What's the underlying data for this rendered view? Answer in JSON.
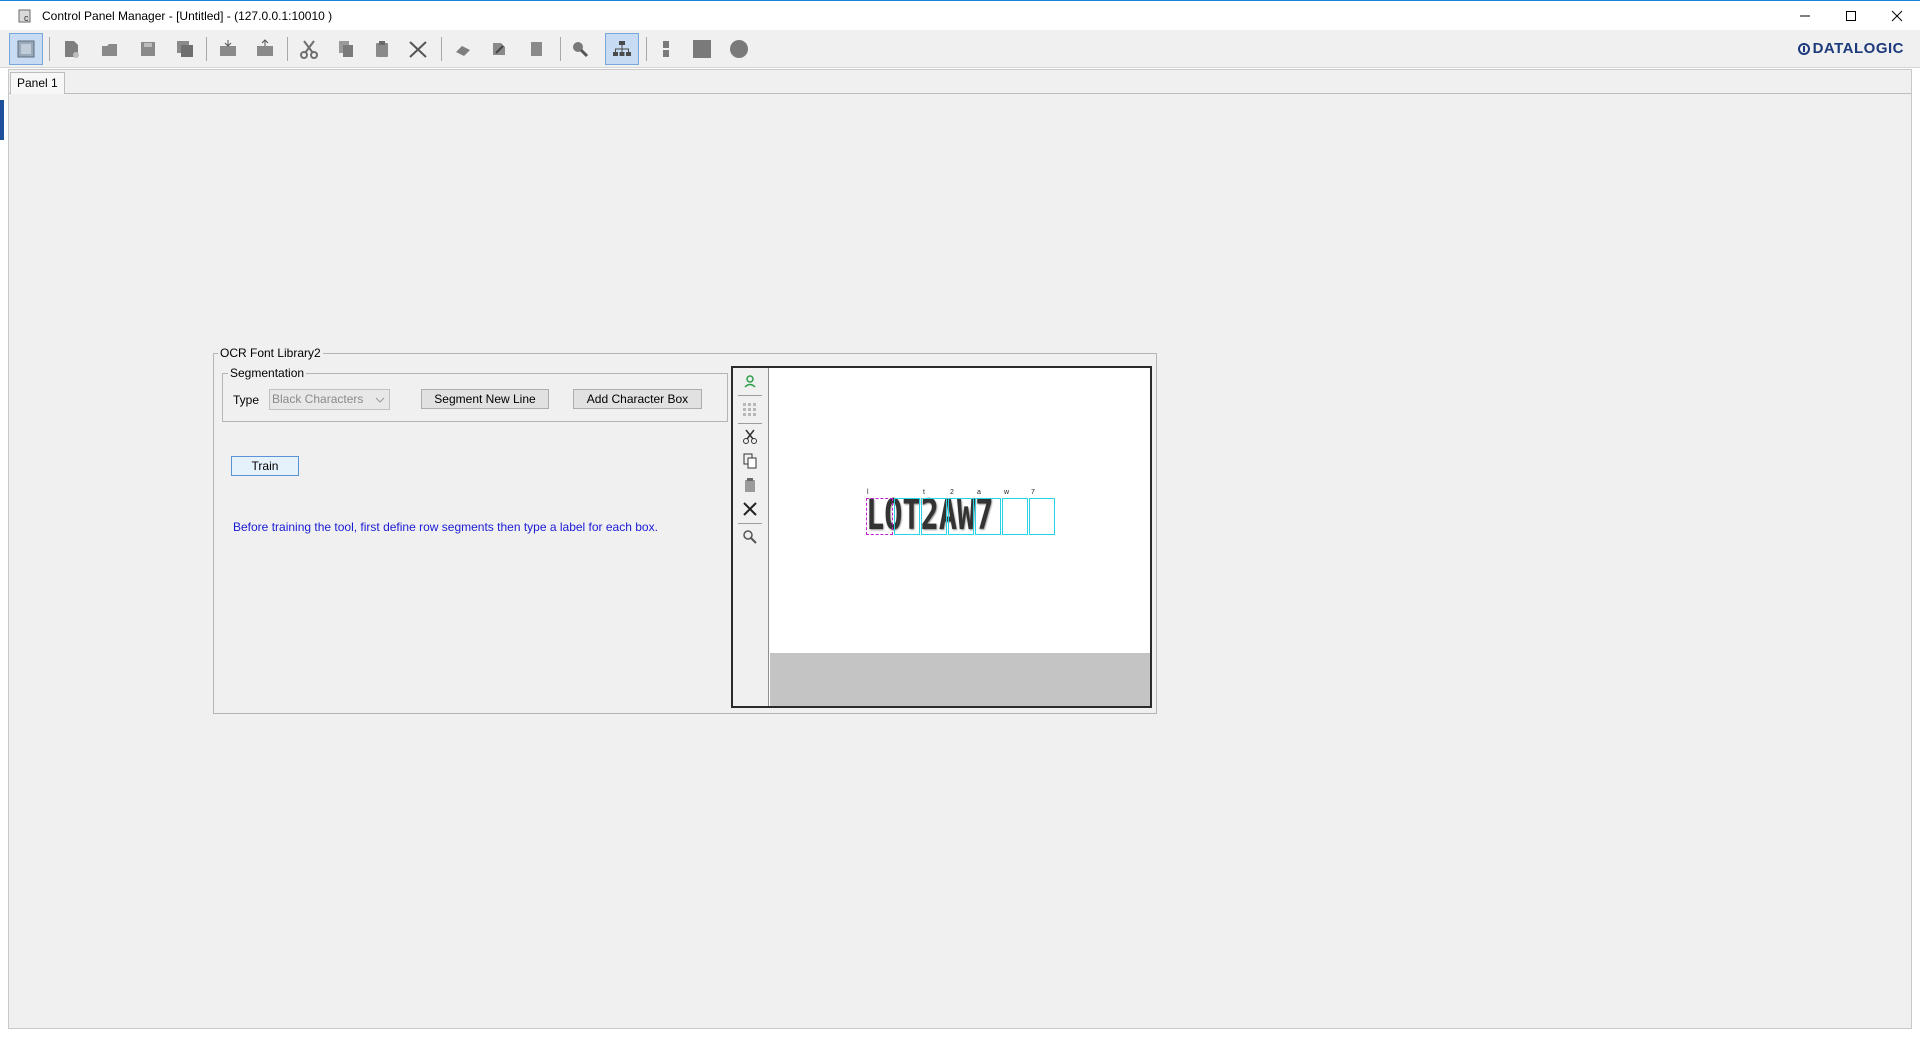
{
  "window": {
    "title": "Control Panel Manager - [Untitled] - (127.0.0.1:10010 )",
    "brand": "DATALOGIC"
  },
  "toolbar": {
    "buttons": [
      "select-icon",
      "new-file-icon",
      "open-icon",
      "save-icon",
      "save-all-icon",
      "load-panel-icon",
      "save-panel-icon",
      "cut-icon",
      "copy-icon",
      "paste-icon",
      "delete-icon",
      "eraser-icon",
      "edit-icon",
      "page-icon",
      "zoom-icon",
      "hierarchy-icon",
      "vertical-dots-icon",
      "square-icon",
      "circle-icon"
    ],
    "active": [
      "select-icon",
      "hierarchy-icon"
    ]
  },
  "tabs": [
    {
      "label": "Panel 1"
    }
  ],
  "ocr_group": {
    "title": "OCR Font Library2",
    "segmentation": {
      "title": "Segmentation",
      "type_label": "Type",
      "type_value": "Black Characters",
      "segment_button": "Segment New Line",
      "add_box_button": "Add Character Box"
    },
    "train_button": "Train",
    "hint": "Before training the tool, first define row segments then type a label for each box."
  },
  "viewer": {
    "sample_text": "LOT2AW7",
    "char_labels": [
      "l",
      "",
      "t",
      "2",
      "a",
      "w",
      "7"
    ],
    "colors": {
      "box": "#29d3e4",
      "selected_box": "#c21fcf"
    }
  }
}
